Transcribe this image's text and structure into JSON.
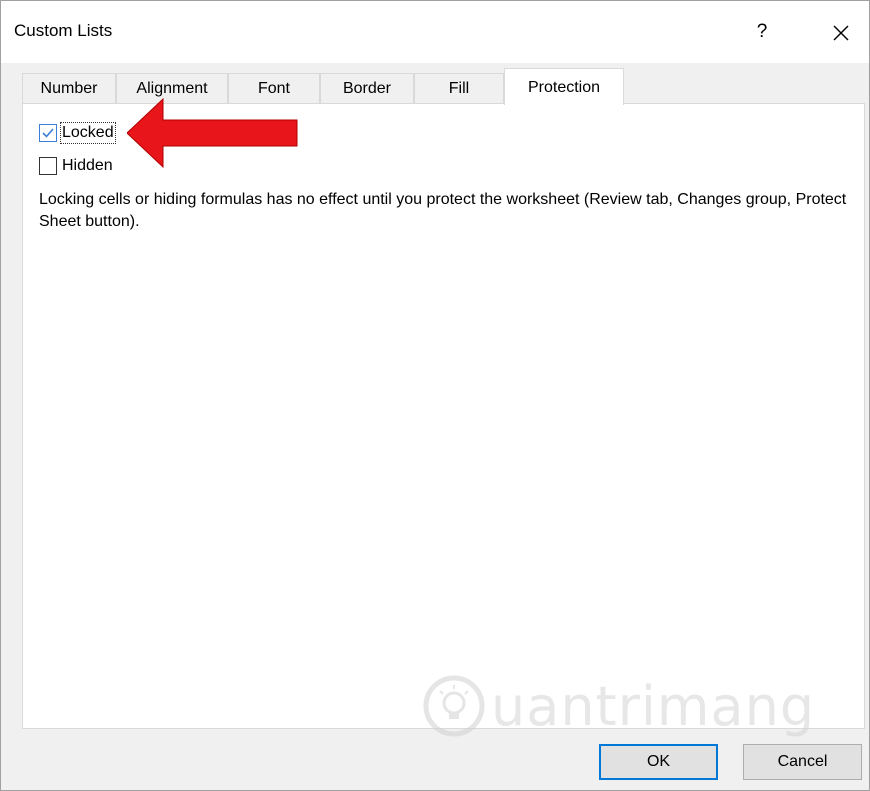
{
  "dialog": {
    "title": "Custom Lists",
    "help_label": "?"
  },
  "tabs": [
    {
      "label": "Number",
      "active": false
    },
    {
      "label": "Alignment",
      "active": false
    },
    {
      "label": "Font",
      "active": false
    },
    {
      "label": "Border",
      "active": false
    },
    {
      "label": "Fill",
      "active": false
    },
    {
      "label": "Protection",
      "active": true
    }
  ],
  "protection": {
    "locked": {
      "label": "Locked",
      "checked": true
    },
    "hidden": {
      "label": "Hidden",
      "checked": false
    },
    "description": "Locking cells or hiding formulas has no effect until you protect the worksheet (Review tab, Changes group, Protect Sheet button)."
  },
  "buttons": {
    "ok": "OK",
    "cancel": "Cancel"
  },
  "watermark": {
    "text": "uantrimang"
  },
  "colors": {
    "accent": "#0078d7",
    "arrow": "#e8151b",
    "check": "#3a7ed6"
  }
}
